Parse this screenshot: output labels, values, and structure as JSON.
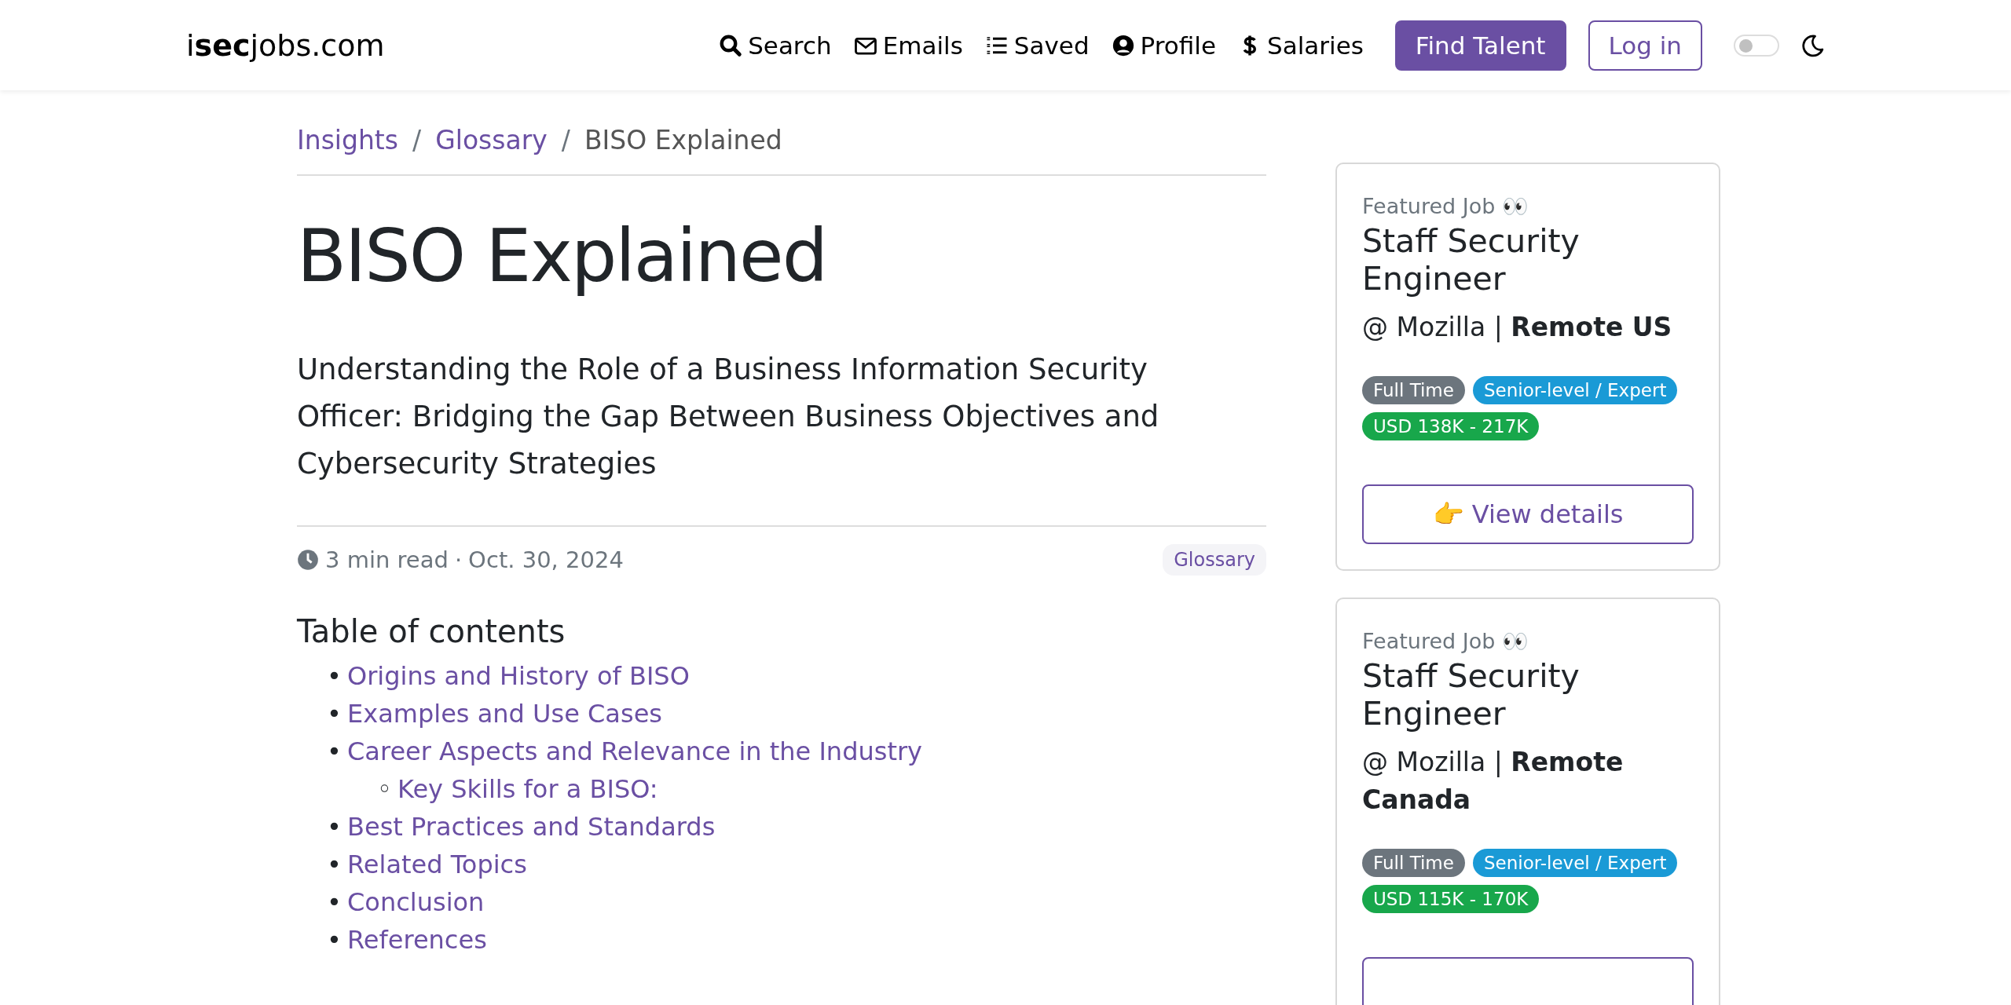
{
  "navbar": {
    "logo": "i**sec**jobs.com",
    "links": [
      {
        "kind": "search",
        "label": "Search"
      },
      {
        "kind": "email",
        "label": "Emails"
      },
      {
        "kind": "list",
        "label": "Saved"
      },
      {
        "kind": "user",
        "label": "Profile"
      },
      {
        "kind": "dollar",
        "label": "Salaries"
      }
    ],
    "primary_button": "Find Talent",
    "login_button": "Log in",
    "dark_mode_toggle": {
      "on": false
    }
  },
  "breadcrumb": [
    {
      "label": "Insights",
      "link": true
    },
    {
      "separator": "/",
      "label": "Glossary",
      "link": true
    },
    {
      "separator": "/",
      "label": "BISO Explained",
      "link": false
    }
  ],
  "article": {
    "title": "BISO Explained",
    "subtitle": "Understanding the Role of a Business Information Security Officer: Bridging the Gap Between Business Objectives and Cybersecurity Strategies",
    "read_time": "3 min read",
    "separator": "·",
    "date": "Oct. 30, 2024",
    "tag": "Glossary",
    "toc_heading": "Table of contents",
    "toc": [
      {
        "marker": "•",
        "label": "Origins and History of BISO"
      },
      {
        "marker": "•",
        "label": "Examples and Use Cases"
      },
      {
        "marker": "•",
        "label": "Career Aspects and Relevance in the Industry",
        "children": [
          {
            "marker": "◦",
            "label": "Key Skills for a BISO:"
          }
        ]
      },
      {
        "marker": "•",
        "label": "Best Practices and Standards"
      },
      {
        "marker": "•",
        "label": "Related Topics"
      },
      {
        "marker": "•",
        "label": "Conclusion"
      },
      {
        "marker": "•",
        "label": "References"
      }
    ]
  },
  "featured_jobs": [
    {
      "label": "Featured Job 👀",
      "title": "Staff Security Engineer",
      "company": "@ Mozilla",
      "separator": "|",
      "location": "Remote US",
      "badges": [
        {
          "label": "Full Time",
          "color": "#6c757d"
        },
        {
          "label": "Senior-level / Expert",
          "color": "#1a9ad6"
        },
        {
          "label": "USD 138K - 217K",
          "color": "#18a74b"
        }
      ],
      "button": "👉 View details"
    },
    {
      "label": "Featured Job 👀",
      "title": "Staff Security Engineer",
      "company": "@ Mozilla",
      "separator": "|",
      "location": "Remote Canada",
      "badges": [
        {
          "label": "Full Time",
          "color": "#6c757d"
        },
        {
          "label": "Senior-level / Expert",
          "color": "#1a9ad6"
        },
        {
          "label": "USD 115K - 170K",
          "color": "#18a74b"
        }
      ]
    }
  ]
}
